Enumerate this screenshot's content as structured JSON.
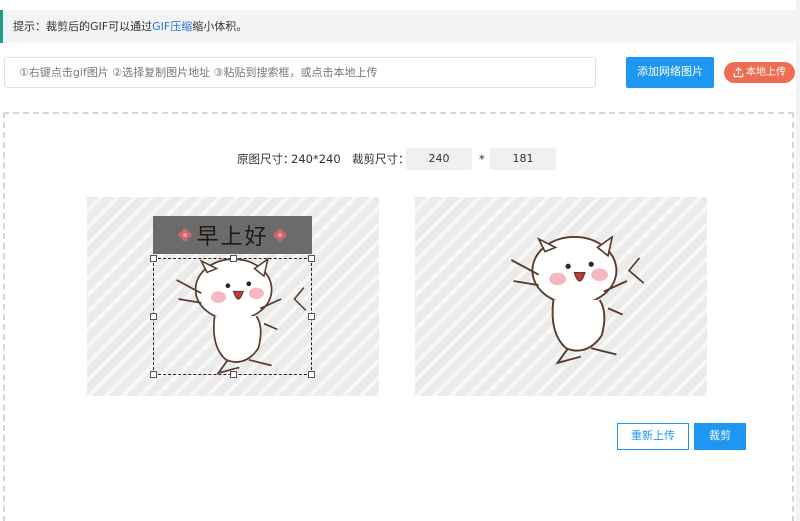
{
  "tip": {
    "prefix": "提示：裁剪后的GIF可以通过",
    "link": "GIF压缩",
    "suffix": "缩小体积。"
  },
  "url_input": {
    "placeholder": "①右键点击gif图片 ②选择复制图片地址 ③粘贴到搜索框，或点击本地上传"
  },
  "buttons": {
    "add_url": "添加网络图片",
    "local_upload": "本地上传",
    "reupload": "重新上传",
    "crop": "裁剪"
  },
  "size": {
    "original_label": "原图尺寸：",
    "original_value": "240*240",
    "crop_label": "裁剪尺寸：",
    "crop_width": "240",
    "times": "*",
    "crop_height": "181"
  },
  "image": {
    "banner_text": "早上好"
  },
  "colors": {
    "primary": "#1e97f2",
    "accent_orange": "#ee6e55",
    "tip_border": "#1e9e86"
  }
}
